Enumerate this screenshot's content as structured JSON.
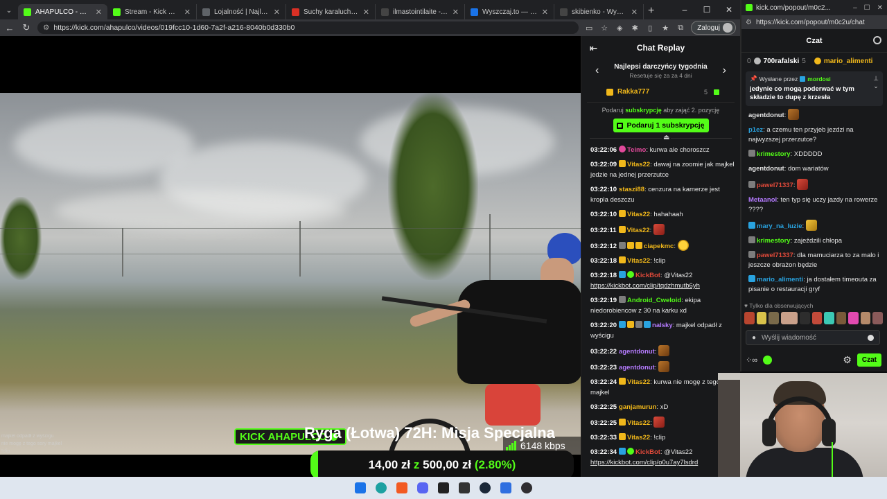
{
  "browser": {
    "tabs": [
      {
        "title": "AHAPULCO - Watch",
        "icon": "kick-icon",
        "active": true
      },
      {
        "title": "Stream - Kick Dashboard",
        "icon": "kick-icon",
        "active": false
      },
      {
        "title": "Lojalność | Najlepsze op",
        "icon": "globe-icon",
        "active": false
      },
      {
        "title": "Suchy karaluch - cypis -",
        "icon": "youtube-icon",
        "active": false
      },
      {
        "title": "ilmastointilaite - Wyszuk",
        "icon": "search-icon",
        "active": false
      },
      {
        "title": "Wyszczaj.to — znajdź na",
        "icon": "page-icon",
        "active": false
      },
      {
        "title": "skibienko - Wyszukaj",
        "icon": "search-icon",
        "active": false
      }
    ],
    "url": "https://kick.com/ahapulco/videos/019fcc10-1d60-7a2f-a216-8040b0d330b0",
    "login_label": "Zaloguj"
  },
  "video": {
    "channel_badge": {
      "prefix": "KICK",
      "name": "AHAPULCO"
    },
    "bitrate": "6148 kbps",
    "mini_chat": [
      {
        "user": "",
        "text": "majkel odpadł z wyścigu"
      },
      {
        "user": "",
        "text": ""
      },
      {
        "user": "",
        "text": ""
      },
      {
        "user": "",
        "text": ""
      },
      {
        "user": "",
        "text": "nie mogę z tego sory majkel"
      },
      {
        "user": "",
        "text": ""
      },
      {
        "user": "",
        "text": "!clip"
      },
      {
        "user": "",
        "text": ""
      },
      {
        "user": "KickBot",
        "text": "@Vitas22 https://kickbot.com/clip/o0u7ay7lsdrd"
      }
    ]
  },
  "goal": {
    "title": "Ryga (Łotwa) 72H: Misja Specjalna",
    "current": "14,00 zł",
    "sep": "z",
    "target": "500,00 zł",
    "percent_label": "(2.80%)",
    "percent": 2.8
  },
  "replay": {
    "title": "Chat Replay",
    "top_title": "Najlepsi darczyńcy tygodnia",
    "top_reset": "Resetuje się za za 4 dni",
    "top_donor": {
      "name": "Rakka777",
      "count": "5"
    },
    "gift_info_pre": "Podaruj",
    "gift_info_link": "subskrypcję",
    "gift_info_post": "aby zająć 2. pozycję",
    "gift_button": "Podaruj 1 subskrypcję",
    "messages": [
      {
        "time": "03:22:06",
        "badges": [
          "pink"
        ],
        "user": "Teimo",
        "color": "#e24a9b",
        "text": "kurwa ale choroszcz"
      },
      {
        "time": "03:22:09",
        "badges": [
          "crown"
        ],
        "user": "Vitas22",
        "color": "#f1b81b",
        "text": "dawaj na zoomie jak majkel jedzie na jednej przerzutce"
      },
      {
        "time": "03:22:10",
        "badges": [],
        "user": "staszi88",
        "color": "#f1b81b",
        "text": "cenzura na kamerze jest kropla deszczu"
      },
      {
        "time": "03:22:10",
        "badges": [
          "crown"
        ],
        "user": "Vitas22",
        "color": "#f1b81b",
        "text": "hahahaah"
      },
      {
        "time": "03:22:11",
        "badges": [
          "crown"
        ],
        "user": "Vitas22",
        "color": "#f1b81b",
        "text": "",
        "emote": "red"
      },
      {
        "time": "03:22:12",
        "badges": [
          "og",
          "crown",
          "crown"
        ],
        "user": "ciapekmc",
        "color": "#f1b81b",
        "text": "",
        "emote": "yel"
      },
      {
        "time": "03:22:18",
        "badges": [
          "crown"
        ],
        "user": "Vitas22",
        "color": "#f1b81b",
        "text": "!clip"
      },
      {
        "time": "03:22:18",
        "badges": [
          "mod",
          "ver"
        ],
        "user": "KickBot",
        "color": "#e24a3a",
        "text": "@Vitas22",
        "link": "https://kickbot.com/clip/tqdzhmutb6yh"
      },
      {
        "time": "03:22:19",
        "badges": [
          "og"
        ],
        "user": "Android_Cweloid",
        "color": "#53fc18",
        "text": "ekipa niedorobiencow z 30 na karku xd"
      },
      {
        "time": "03:22:20",
        "badges": [
          "mod",
          "crown",
          "og",
          "mod"
        ],
        "user": "nalsky",
        "color": "#b57bff",
        "text": "majkel odpadł z wyścigu"
      },
      {
        "time": "03:22:22",
        "badges": [],
        "user": "agentdonut",
        "color": "#b57bff",
        "text": "",
        "emote": "brown"
      },
      {
        "time": "03:22:23",
        "badges": [],
        "user": "agentdonut",
        "color": "#b57bff",
        "text": "",
        "emote": "brown"
      },
      {
        "time": "03:22:24",
        "badges": [
          "crown"
        ],
        "user": "Vitas22",
        "color": "#f1b81b",
        "text": "kurwa nie mogę z tego sory majkel"
      },
      {
        "time": "03:22:25",
        "badges": [],
        "user": "ganjamurun",
        "color": "#f1b81b",
        "text": "xD"
      },
      {
        "time": "03:22:25",
        "badges": [
          "crown"
        ],
        "user": "Vitas22",
        "color": "#f1b81b",
        "text": "",
        "emote": "red"
      },
      {
        "time": "03:22:33",
        "badges": [
          "crown"
        ],
        "user": "Vitas22",
        "color": "#f1b81b",
        "text": "!clip"
      },
      {
        "time": "03:22:34",
        "badges": [
          "mod",
          "ver"
        ],
        "user": "KickBot",
        "color": "#e24a3a",
        "text": "@Vitas22",
        "link": "https://kickbot.com/clip/o0u7ay7lsdrd"
      }
    ]
  },
  "popout": {
    "window_title": "kick.com/popout/m0c2...",
    "url": "https://kick.com/popout/m0c2u/chat",
    "header": "Czat",
    "leaderboard": {
      "rank": "0",
      "user1": "700rafalski",
      "score1": "5",
      "user2": "mario_alimenti"
    },
    "pinned": {
      "by_label": "Wysłane przez",
      "by_user": "mordosi",
      "text": "jedynie co mogą poderwać w tym składzie to dupę z krzesła"
    },
    "messages": [
      {
        "user": "agentdonut",
        "color": "#e6e6e6",
        "text": "",
        "emote": "brown",
        "badges": []
      },
      {
        "user": "p1ez",
        "color": "#29a3e0",
        "text": "a czemu ten przyjeb jezdzi na najwyzszej przerzutce?",
        "badges": []
      },
      {
        "user": "krimestory",
        "color": "#53fc18",
        "text": "XDDDDD",
        "badges": [
          "og"
        ]
      },
      {
        "user": "agentdonut",
        "color": "#e6e6e6",
        "text": "dom wariatów",
        "badges": []
      },
      {
        "user": "pawel71337",
        "color": "#e24a3a",
        "text": "",
        "emote": "red",
        "badges": [
          "og"
        ]
      },
      {
        "user": "Metaanol",
        "color": "#b57bff",
        "text": "ten typ się uczy jazdy na rowerze ????",
        "badges": []
      },
      {
        "user": "mary_na_luzie",
        "color": "#29a3e0",
        "text": "",
        "emote": "yelbox",
        "badges": [
          "mod"
        ]
      },
      {
        "user": "krimestory",
        "color": "#53fc18",
        "text": "zajeździli chłopa",
        "badges": [
          "og"
        ]
      },
      {
        "user": "pawel71337",
        "color": "#e24a3a",
        "text": "dla mamuciarza to za malo i jeszcze obrażon będzie",
        "badges": [
          "og"
        ]
      },
      {
        "user": "mario_alimenti",
        "color": "#29a3e0",
        "text": "ja dostałem timeouta za pisanie o restauracji gryf",
        "badges": [
          "mod"
        ]
      }
    ],
    "followers_only": "Tylko dla obserwujących",
    "input_placeholder": "Wyślij wiadomość",
    "chat_button": "Czat"
  }
}
